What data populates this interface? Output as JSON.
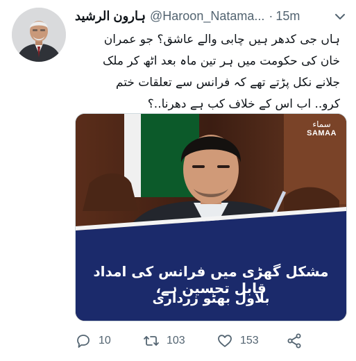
{
  "tweet": {
    "author": {
      "display_name": "ہارون الرشید",
      "handle": "@Haroon_Natama...",
      "separator": "·",
      "time": "15m"
    },
    "text_lines": [
      "ہاں جی کدھر ہیں چابی والے عاشق؟ جو عمران",
      "خان کی حکومت میں ہر تین ماہ بعد اٹھ کر ملک",
      "جلانے نکل پڑتے تھے کہ فرانس سے تعلقات ختم",
      "کرو.. اب اس کے خلاف کب ہے دھرنا..؟"
    ],
    "media": {
      "brand_ur": "سماء",
      "brand_en": "SAMAA",
      "caption_line1": "مشکل گھڑی میں فرانس کی امداد قابل تحسین ہے،",
      "caption_line2": "بلاول بھٹو زرداری"
    },
    "actions": {
      "reply_count": "10",
      "retweet_count": "103",
      "like_count": "153"
    },
    "icons": [
      "more-caret-icon",
      "reply-icon",
      "retweet-icon",
      "like-icon",
      "share-icon"
    ],
    "colors": {
      "text": "#0f1419",
      "secondary": "#536471",
      "banner": "#1b2a6b"
    }
  }
}
